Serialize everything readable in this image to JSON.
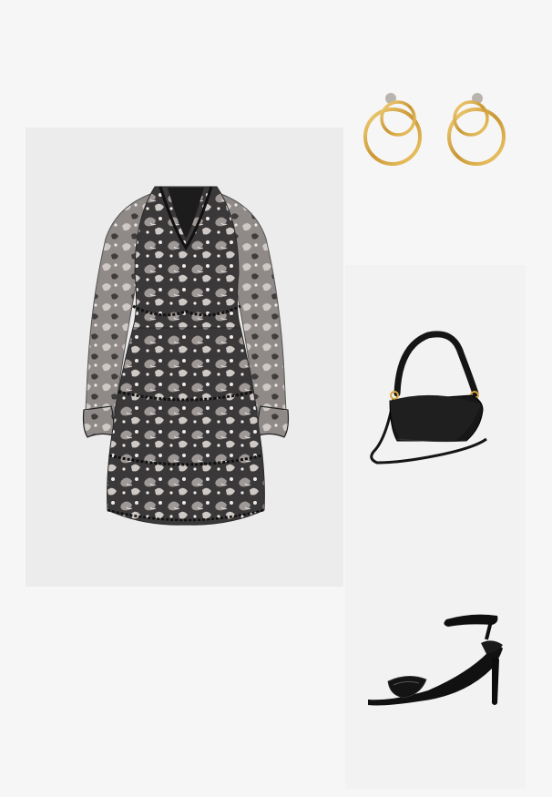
{
  "outfit": {
    "items": [
      {
        "kind": "dress",
        "icon": "dress-image",
        "color": "#2b2b2b",
        "accent": "#bdb6b3"
      },
      {
        "kind": "earrings",
        "icon": "earrings-image",
        "color": "#d9a845"
      },
      {
        "kind": "shoulder-bag",
        "icon": "bag-image",
        "color": "#161616"
      },
      {
        "kind": "heeled-sandal",
        "icon": "sandal-image",
        "color": "#111111"
      }
    ],
    "background": "#f6f6f6",
    "panel_colors": [
      "#ececec",
      "#f2f2f2"
    ]
  }
}
